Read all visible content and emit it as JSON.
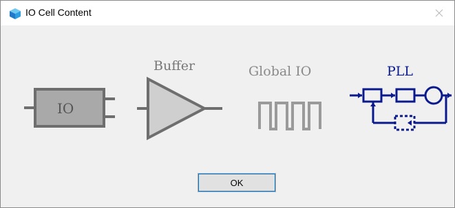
{
  "window": {
    "title": "IO Cell Content",
    "icon": "cube-icon",
    "close_icon": "close-icon"
  },
  "items": [
    {
      "name": "io",
      "label": "IO",
      "icon": "io-cell-icon"
    },
    {
      "name": "buffer",
      "label": "Buffer",
      "icon": "buffer-triangle-icon"
    },
    {
      "name": "global-io",
      "label": "Global IO",
      "icon": "square-wave-icon"
    },
    {
      "name": "pll",
      "label": "PLL",
      "icon": "pll-loop-icon"
    }
  ],
  "colors": {
    "gray_icon": "#6e6e6e",
    "light_gray_caption": "#8a8a8a",
    "pll_blue": "#0a1a8c",
    "accent": "#0078d7"
  },
  "ok_label": "OK"
}
